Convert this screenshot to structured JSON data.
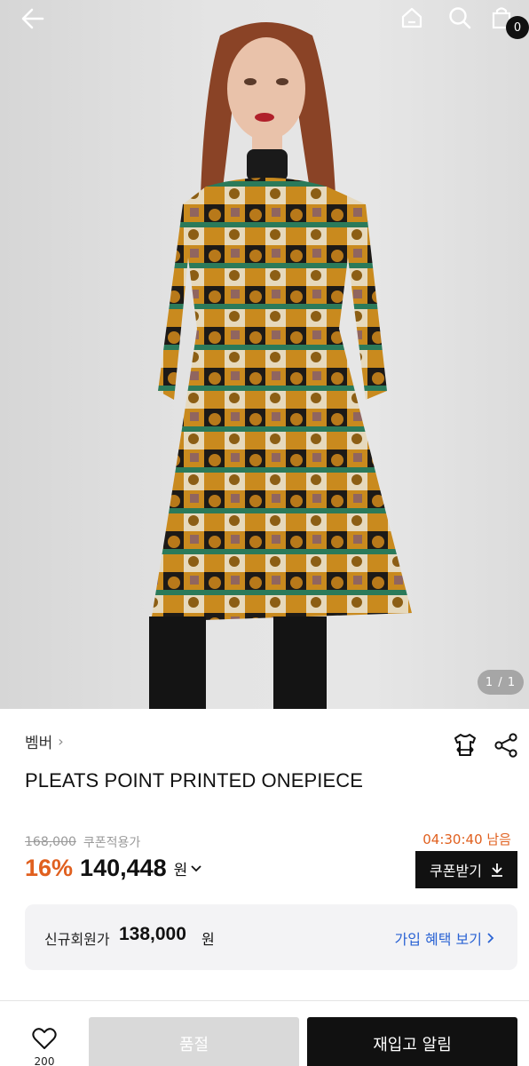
{
  "header": {
    "back_icon": "arrow-left-icon",
    "home_icon": "home-icon",
    "search_icon": "search-icon",
    "cart_icon": "shopping-bag-icon",
    "cart_count": "0"
  },
  "gallery": {
    "counter": "1 / 1"
  },
  "product": {
    "brand": "벰버",
    "brand_chevron": "›",
    "name": "PLEATS POINT PRINTED ONEPIECE",
    "icons": [
      "size-guide-shirt-icon",
      "share-icon"
    ]
  },
  "pricing": {
    "original_price": "168,000",
    "coupon_note": "쿠폰적용가",
    "timer": "04:30:40 남음",
    "discount": "16%",
    "price": "140,448",
    "currency": "원",
    "coupon_button": "쿠폰받기"
  },
  "member": {
    "label": "신규회원가",
    "price": "138,000",
    "currency": "원",
    "link": "가입 혜택 보기"
  },
  "bottom_bar": {
    "like_count": "200",
    "soldout_label": "품절",
    "restock_label": "재입고 알림"
  },
  "colors": {
    "accent": "#e0601f",
    "link": "#2a63d4",
    "dark": "#111111"
  }
}
